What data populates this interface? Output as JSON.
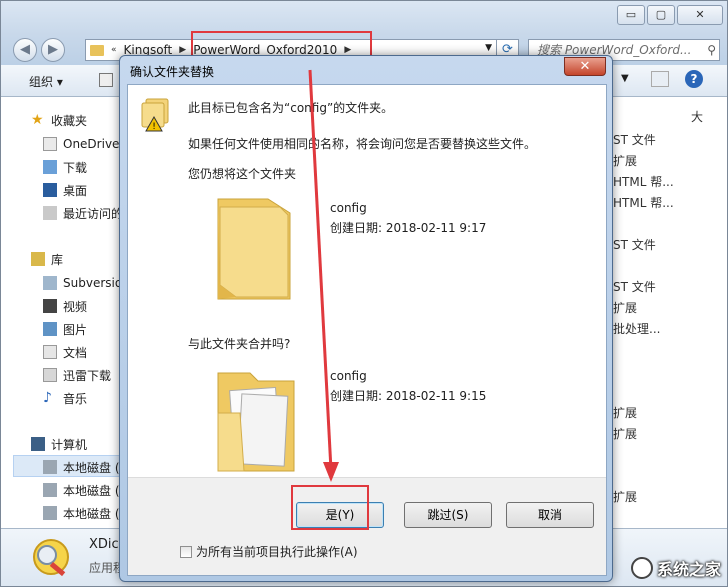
{
  "explorer": {
    "nav_back": "◀",
    "nav_forward": "▶",
    "breadcrumb": [
      "Kingsoft",
      "PowerWord_Oxford2010"
    ],
    "breadcrumb_prefix": "«",
    "search_placeholder": "搜索 PowerWord_Oxford...",
    "organize_label": "组织 ▾",
    "window_buttons": {
      "minimize": "▭",
      "maximize": "▢",
      "close": "✕"
    },
    "help_label": "?",
    "sidebar": {
      "favorites": "收藏夹",
      "favorites_items": [
        "OneDrive",
        "下载",
        "桌面",
        "最近访问的"
      ],
      "libraries": "库",
      "library_items": [
        "Subversio",
        "视频",
        "图片",
        "文档",
        "迅雷下载",
        "音乐"
      ],
      "computer": "计算机",
      "drives": [
        "本地磁盘 (",
        "本地磁盘 (",
        "本地磁盘 ("
      ]
    },
    "right_column": {
      "header": "大",
      "rows": [
        "ST 文件",
        "扩展",
        "HTML 帮...",
        "HTML 帮...",
        "ST 文件",
        "ST 文件",
        "扩展",
        "批处理...",
        "扩展",
        "扩展",
        "扩展"
      ]
    },
    "status": {
      "app_name": "XDict",
      "app_type": "应用程",
      "watermark": "系统之家"
    }
  },
  "dialog": {
    "title": "确认文件夹替换",
    "close_label": "✕",
    "message_line1": "此目标已包含名为“config”的文件夹。",
    "message_line2": "如果任何文件使用相同的名称，将会询问您是否要替换这些文件。",
    "question1": "您仍想将这个文件夹",
    "question2": "与此文件夹合并吗?",
    "source": {
      "name": "config",
      "created": "创建日期: 2018-02-11 9:17"
    },
    "target": {
      "name": "config",
      "created": "创建日期: 2018-02-11 9:15"
    },
    "buttons": {
      "yes": "是(Y)",
      "skip": "跳过(S)",
      "cancel": "取消"
    },
    "checkbox_label": "为所有当前项目执行此操作(A)"
  },
  "colors": {
    "annotation": "#e0393e",
    "folder": "#f3d37a",
    "help": "#2a66b8"
  }
}
